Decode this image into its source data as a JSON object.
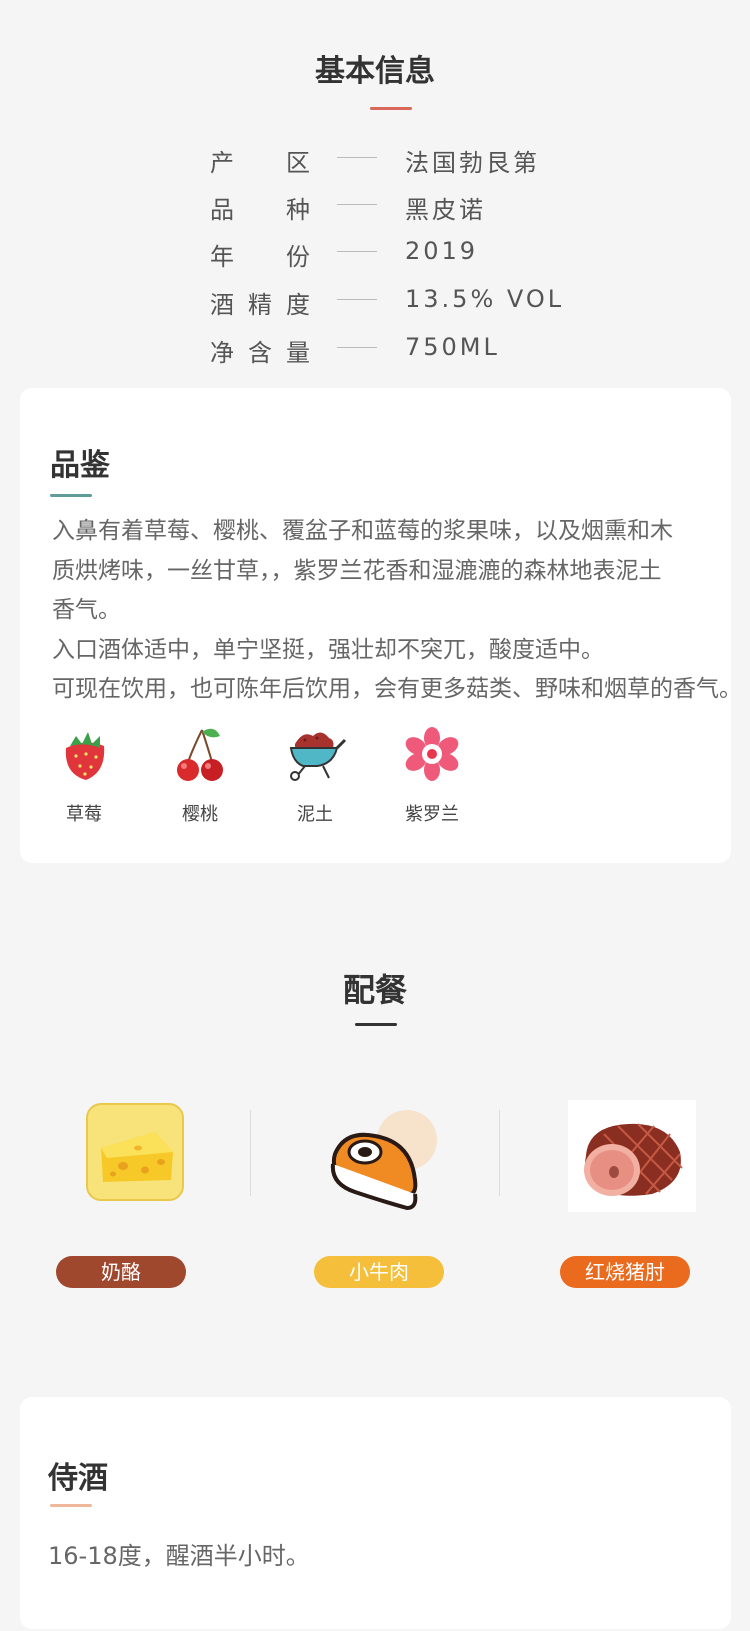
{
  "basic_info": {
    "title": "基本信息",
    "rows": [
      {
        "label_chars": [
          "产",
          "区"
        ],
        "value": "法国勃艮第"
      },
      {
        "label_chars": [
          "品",
          "种"
        ],
        "value": "黑皮诺"
      },
      {
        "label_chars": [
          "年",
          "份"
        ],
        "value": "2019"
      },
      {
        "label_chars": [
          "酒",
          "精",
          "度"
        ],
        "value": "13.5% VOL"
      },
      {
        "label_chars": [
          "净",
          "含",
          "量"
        ],
        "value": "750ML"
      }
    ]
  },
  "tasting": {
    "title": "品鉴",
    "lines": [
      "入鼻有着草莓、樱桃、覆盆子和蓝莓的浆果味，以及烟熏和木",
      "质烘烤味，一丝甘草，，紫罗兰花香和湿漉漉的森林地表泥土",
      "香气。",
      "入口酒体适中，单宁坚挺，强壮却不突兀，酸度适中。",
      "可现在饮用，也可陈年后饮用，会有更多菇类、野味和烟草的香气。"
    ],
    "aromas": [
      {
        "label": "草莓",
        "icon": "strawberry-icon"
      },
      {
        "label": "樱桃",
        "icon": "cherry-icon"
      },
      {
        "label": "泥土",
        "icon": "soil-wheelbarrow-icon"
      },
      {
        "label": "紫罗兰",
        "icon": "violet-flower-icon"
      }
    ]
  },
  "pairing": {
    "title": "配餐",
    "foods": [
      {
        "label": "奶酪",
        "icon": "cheese-icon",
        "color": "#a0482e"
      },
      {
        "label": "小牛肉",
        "icon": "veal-steak-icon",
        "color": "#f5bf3c"
      },
      {
        "label": "红烧猪肘",
        "icon": "braised-pork-knuckle-icon",
        "color": "#ea6a1e"
      }
    ]
  },
  "serving": {
    "title": "侍酒",
    "text": "16-18度，醒酒半小时。"
  },
  "colors": {
    "accent_red": "#d9675a",
    "accent_teal": "#5f9c9a",
    "accent_dark": "#333333",
    "accent_peach": "#f0b89a"
  }
}
